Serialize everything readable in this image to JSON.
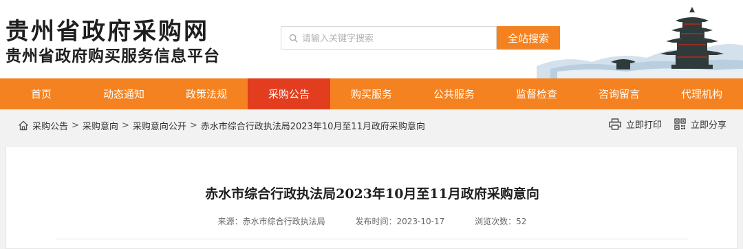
{
  "header": {
    "site_title": "贵州省政府采购网",
    "site_subtitle": "贵州省政府购买服务信息平台"
  },
  "search": {
    "placeholder": "请输入关键字搜索",
    "button_label": "全站搜索"
  },
  "nav": {
    "items": [
      {
        "label": "首页"
      },
      {
        "label": "动态通知"
      },
      {
        "label": "政策法规"
      },
      {
        "label": "采购公告"
      },
      {
        "label": "购买服务"
      },
      {
        "label": "公共服务"
      },
      {
        "label": "监督检查"
      },
      {
        "label": "咨询留言"
      },
      {
        "label": "代理机构"
      }
    ],
    "active": "采购公告"
  },
  "breadcrumb": {
    "items": [
      "采购公告",
      "采购意向",
      "采购意向公开",
      "赤水市综合行政执法局2023年10月至11月政府采购意向"
    ],
    "separator": ">"
  },
  "tools": {
    "print_label": "立即打印",
    "share_label": "立即分享"
  },
  "article": {
    "title": "赤水市综合行政执法局2023年10月至11月政府采购意向",
    "source": "来源：赤水市综合行政执法局",
    "publish_time": "发布时间：2023-10-17",
    "views": "浏览次数：52"
  },
  "colors": {
    "accent": "#f58220",
    "nav_active": "#e23d1f"
  }
}
